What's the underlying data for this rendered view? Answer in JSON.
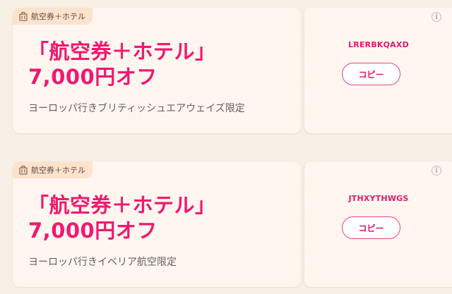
{
  "coupons": [
    {
      "tag": "航空券＋ホテル",
      "title_line1": "「航空券＋ホテル」",
      "title_line2": "7,000円オフ",
      "condition": "ヨーロッパ行きブリティッシュエアウェイズ限定",
      "code": "LRERBKQAXD",
      "copy_label": "コピー",
      "info_icon": "info-icon"
    },
    {
      "tag": "航空券＋ホテル",
      "title_line1": "「航空券＋ホテル」",
      "title_line2": "7,000円オフ",
      "condition": "ヨーロッパ行きイベリア航空限定",
      "code": "JTHXYTHWGS",
      "copy_label": "コピー",
      "info_icon": "info-icon"
    }
  ],
  "colors": {
    "background": "#f6f0e7",
    "card": "#fff6f0",
    "tag_bg": "#fde2cc",
    "accent": "#f0196e",
    "text_muted": "#6b5d58"
  }
}
